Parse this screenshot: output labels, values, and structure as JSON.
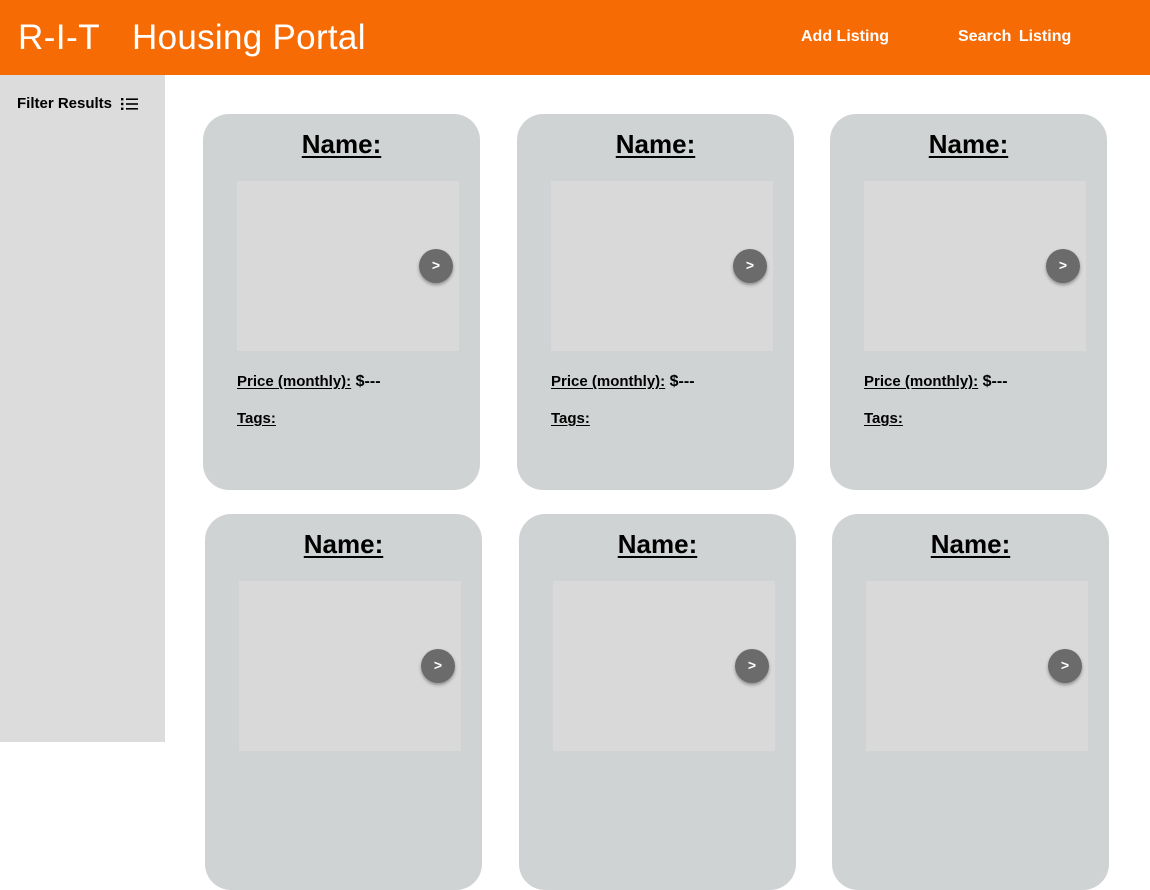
{
  "header": {
    "brand": "R-I-T",
    "title": "Housing Portal",
    "nav": {
      "add_listing": "Add Listing",
      "search_listing": "Search Listing"
    },
    "background_color": "#f76b05"
  },
  "sidebar": {
    "filter_label": "Filter Results",
    "filter_icon": "list-icon"
  },
  "listings": [
    {
      "name_label": "Name:",
      "next_label": ">",
      "price_label": "Price (monthly):",
      "price_value": " $---",
      "tags_label": "Tags:"
    },
    {
      "name_label": "Name:",
      "next_label": ">",
      "price_label": "Price (monthly):",
      "price_value": " $---",
      "tags_label": "Tags:"
    },
    {
      "name_label": "Name:",
      "next_label": ">",
      "price_label": "Price (monthly):",
      "price_value": " $---",
      "tags_label": "Tags:"
    },
    {
      "name_label": "Name:",
      "next_label": ">"
    },
    {
      "name_label": "Name:",
      "next_label": ">"
    },
    {
      "name_label": "Name:",
      "next_label": ">"
    }
  ]
}
